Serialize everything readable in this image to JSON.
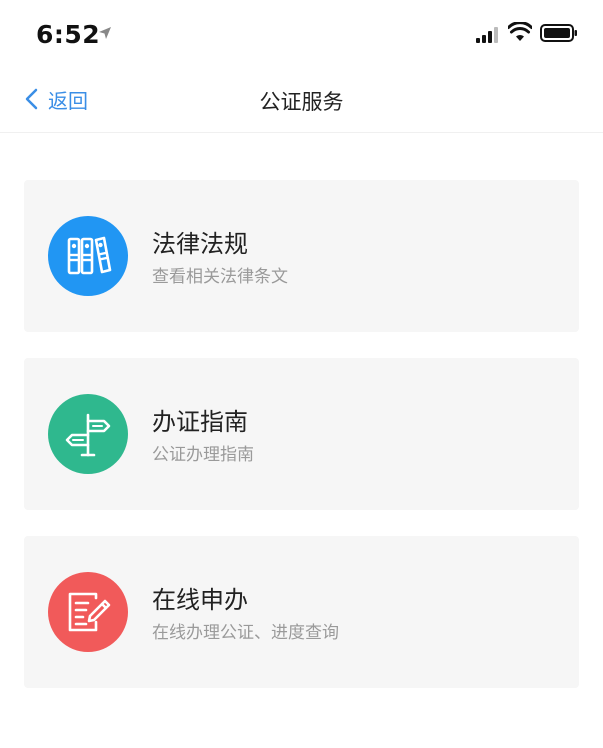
{
  "status_bar": {
    "time": "6:52",
    "location_icon": "location-arrow-icon",
    "signal_icon": "cellular-signal-icon",
    "wifi_icon": "wifi-icon",
    "battery_icon": "battery-icon"
  },
  "nav": {
    "back_label": "返回",
    "title": "公证服务"
  },
  "services": [
    {
      "title": "法律法规",
      "description": "查看相关法律条文",
      "icon": "books-icon",
      "icon_color": "#2196f3"
    },
    {
      "title": "办证指南",
      "description": "公证办理指南",
      "icon": "signpost-icon",
      "icon_color": "#2fb88e"
    },
    {
      "title": "在线申办",
      "description": "在线办理公证、进度查询",
      "icon": "document-edit-icon",
      "icon_color": "#f15a5a"
    }
  ],
  "colors": {
    "accent": "#3a8ee6",
    "card_background": "#f6f6f6"
  }
}
